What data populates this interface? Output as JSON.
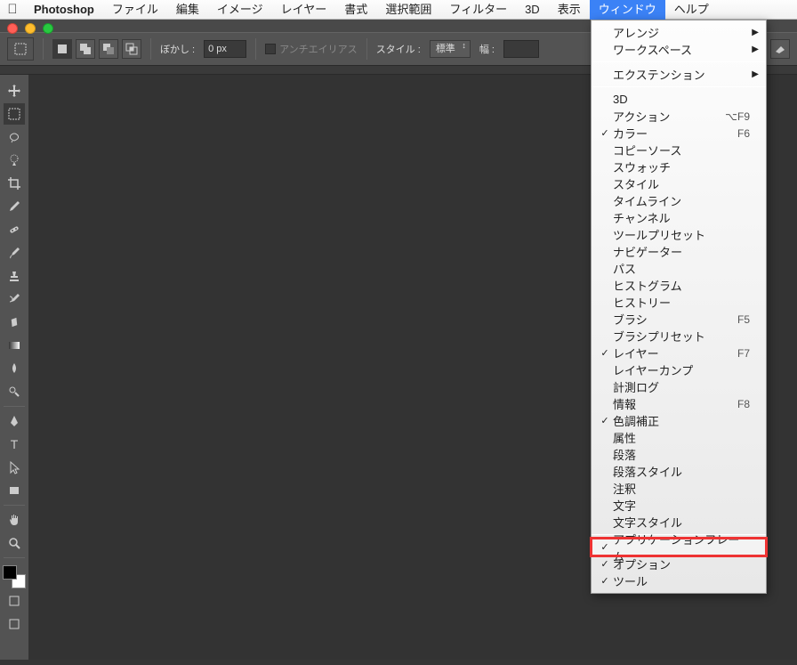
{
  "menubar": {
    "app_name": "Photoshop",
    "items": [
      "ファイル",
      "編集",
      "イメージ",
      "レイヤー",
      "書式",
      "選択範囲",
      "フィルター",
      "3D",
      "表示",
      "ウィンドウ",
      "ヘルプ"
    ],
    "active_index": 9
  },
  "options_bar": {
    "feather_label": "ぼかし :",
    "feather_value": "0 px",
    "antialias_label": "アンチエイリアス",
    "style_label": "スタイル :",
    "style_value": "標準",
    "width_label": "幅 :",
    "width_value": ""
  },
  "window_menu": {
    "items": [
      {
        "type": "item",
        "label": "アレンジ",
        "submenu": true
      },
      {
        "type": "item",
        "label": "ワークスペース",
        "submenu": true
      },
      {
        "type": "sep"
      },
      {
        "type": "item",
        "label": "エクステンション",
        "submenu": true
      },
      {
        "type": "sep"
      },
      {
        "type": "item",
        "label": "3D"
      },
      {
        "type": "item",
        "label": "アクション",
        "shortcut": "⌥F9"
      },
      {
        "type": "item",
        "label": "カラー",
        "checked": true,
        "shortcut": "F6"
      },
      {
        "type": "item",
        "label": "コピーソース"
      },
      {
        "type": "item",
        "label": "スウォッチ"
      },
      {
        "type": "item",
        "label": "スタイル"
      },
      {
        "type": "item",
        "label": "タイムライン"
      },
      {
        "type": "item",
        "label": "チャンネル"
      },
      {
        "type": "item",
        "label": "ツールプリセット"
      },
      {
        "type": "item",
        "label": "ナビゲーター"
      },
      {
        "type": "item",
        "label": "パス"
      },
      {
        "type": "item",
        "label": "ヒストグラム"
      },
      {
        "type": "item",
        "label": "ヒストリー"
      },
      {
        "type": "item",
        "label": "ブラシ",
        "shortcut": "F5"
      },
      {
        "type": "item",
        "label": "ブラシプリセット"
      },
      {
        "type": "item",
        "label": "レイヤー",
        "checked": true,
        "shortcut": "F7"
      },
      {
        "type": "item",
        "label": "レイヤーカンプ"
      },
      {
        "type": "item",
        "label": "計測ログ"
      },
      {
        "type": "item",
        "label": "情報",
        "shortcut": "F8"
      },
      {
        "type": "item",
        "label": "色調補正",
        "checked": true
      },
      {
        "type": "item",
        "label": "属性"
      },
      {
        "type": "item",
        "label": "段落"
      },
      {
        "type": "item",
        "label": "段落スタイル"
      },
      {
        "type": "item",
        "label": "注釈"
      },
      {
        "type": "item",
        "label": "文字"
      },
      {
        "type": "item",
        "label": "文字スタイル"
      },
      {
        "type": "sep"
      },
      {
        "type": "item",
        "label": "アプリケーションフレーム",
        "checked": true,
        "highlight": true
      },
      {
        "type": "item",
        "label": "オプション",
        "checked": true
      },
      {
        "type": "item",
        "label": "ツール",
        "checked": true
      }
    ]
  },
  "tools": [
    "move",
    "marquee",
    "lasso",
    "quick-select",
    "crop",
    "eyedropper",
    "healing",
    "brush",
    "stamp",
    "history-brush",
    "eraser",
    "gradient",
    "blur",
    "dodge",
    "pen",
    "type",
    "path-select",
    "rectangle",
    "hand",
    "zoom"
  ],
  "active_tool_index": 1
}
